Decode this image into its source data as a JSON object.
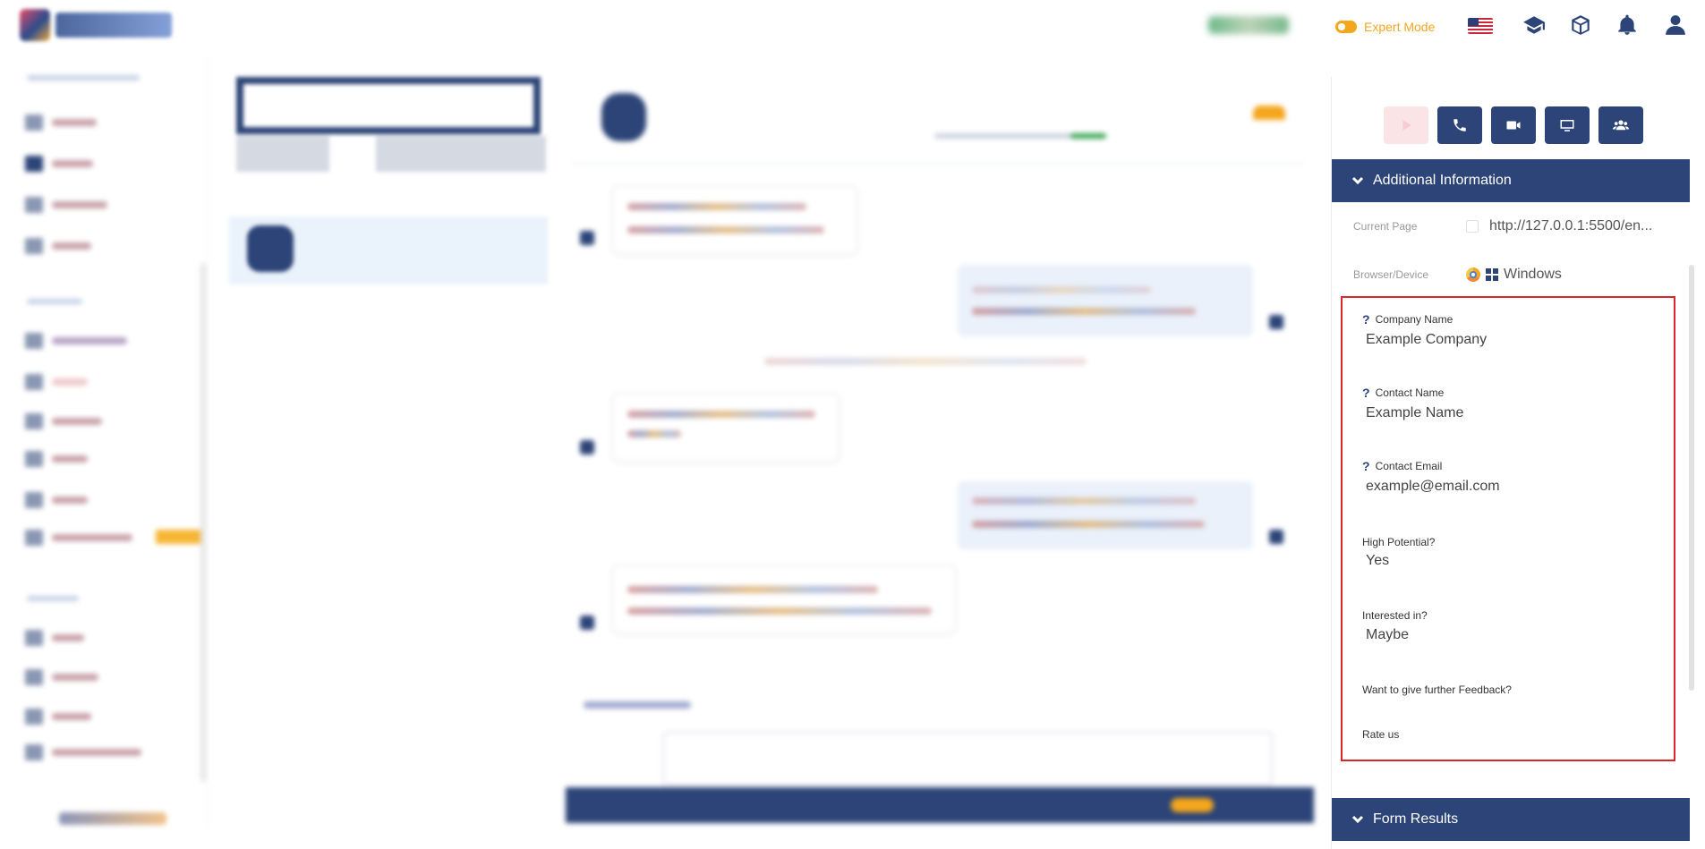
{
  "topbar": {
    "expert_mode_label": "Expert Mode",
    "expert_mode_on": true,
    "icons": [
      "graduation-cap-icon",
      "cube-icon",
      "bell-icon",
      "user-icon"
    ],
    "accent_color": "#f4a61d",
    "brand_color": "#2c4477"
  },
  "right_panel": {
    "action_buttons": [
      "play-icon",
      "phone-icon",
      "video-icon",
      "monitor-icon",
      "users-icon"
    ],
    "additional_info": {
      "title": "Additional Information",
      "current_page_label": "Current Page",
      "current_page_value": "http://127.0.0.1:5500/en...",
      "browser_label": "Browser/Device",
      "browser_value": "Windows"
    },
    "form_fields": [
      {
        "label": "Company Name",
        "value": "Example Company"
      },
      {
        "label": "Contact Name",
        "value": "Example Name"
      },
      {
        "label": "Contact Email",
        "value": "example@email.com"
      },
      {
        "label": "High Potential?",
        "value": "Yes"
      },
      {
        "label": "Interested in?",
        "value": "Maybe"
      },
      {
        "label": "Want to give further Feedback?",
        "value": ""
      },
      {
        "label": "Rate us",
        "value": ""
      }
    ],
    "form_results_title": "Form Results",
    "highlight_color": "#d9262c"
  }
}
